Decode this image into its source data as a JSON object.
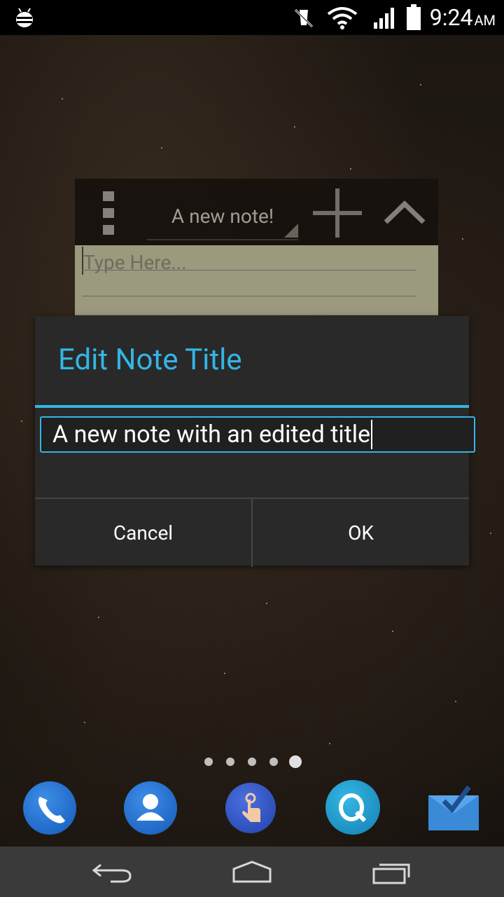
{
  "status_bar": {
    "time": "9:24",
    "ampm": "AM",
    "icons": [
      "debug-bug-icon",
      "mute-icon",
      "wifi-icon",
      "signal-icon",
      "battery-icon"
    ]
  },
  "widget": {
    "note_title": "A new note!",
    "body_placeholder": "Type Here...",
    "icons": [
      "overflow-menu-icon",
      "add-icon",
      "collapse-icon"
    ]
  },
  "dialog": {
    "title": "Edit Note Title",
    "input_value": "A new note with an edited title",
    "cancel_label": "Cancel",
    "ok_label": "OK",
    "accent_color": "#33b5e5"
  },
  "home": {
    "page_count": 5,
    "active_page": 5,
    "dock": [
      "phone-icon",
      "contacts-icon",
      "gesture-app-icon",
      "quip-app-icon",
      "inbox-app-icon"
    ]
  },
  "nav_bar": {
    "buttons": [
      "back-icon",
      "home-icon",
      "recents-icon"
    ]
  }
}
